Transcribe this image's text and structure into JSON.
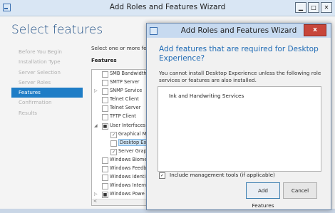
{
  "main": {
    "title": "Add Roles and Features Wizard",
    "heading": "Select features",
    "nav": [
      {
        "label": "Before You Begin",
        "active": false
      },
      {
        "label": "Installation Type",
        "active": false
      },
      {
        "label": "Server Selection",
        "active": false
      },
      {
        "label": "Server Roles",
        "active": false
      },
      {
        "label": "Features",
        "active": true
      },
      {
        "label": "Confirmation",
        "active": false
      },
      {
        "label": "Results",
        "active": false
      }
    ],
    "instruction": "Select one or more featu",
    "features_header": "Features",
    "features": [
      {
        "label": "SMB Bandwidth",
        "level": 0,
        "check": "",
        "exp": ""
      },
      {
        "label": "SMTP Server",
        "level": 0,
        "check": "",
        "exp": ""
      },
      {
        "label": "SNMP Service",
        "level": 0,
        "check": "",
        "exp": "▷"
      },
      {
        "label": "Telnet Client",
        "level": 0,
        "check": "",
        "exp": ""
      },
      {
        "label": "Telnet Server",
        "level": 0,
        "check": "",
        "exp": ""
      },
      {
        "label": "TFTP Client",
        "level": 0,
        "check": "",
        "exp": ""
      },
      {
        "label": "User Interfaces a",
        "level": 0,
        "check": "■",
        "exp": "◢"
      },
      {
        "label": "Graphical Mi",
        "level": 1,
        "check": "✓",
        "exp": ""
      },
      {
        "label": "Desktop Exp",
        "level": 1,
        "check": "",
        "exp": "",
        "selected": true
      },
      {
        "label": "Server Graph",
        "level": 1,
        "check": "✓",
        "exp": ""
      },
      {
        "label": "Windows Biome",
        "level": 0,
        "check": "",
        "exp": ""
      },
      {
        "label": "Windows Feedb",
        "level": 0,
        "check": "",
        "exp": ""
      },
      {
        "label": "Windows Identi",
        "level": 0,
        "check": "",
        "exp": ""
      },
      {
        "label": "Windows Intern",
        "level": 0,
        "check": "",
        "exp": ""
      },
      {
        "label": "Windows Powe",
        "level": 0,
        "check": "■",
        "exp": "▷"
      }
    ]
  },
  "dialog": {
    "title": "Add Roles and Features Wizard",
    "heading": "Add features that are required for Desktop Experience?",
    "message": "You cannot install Desktop Experience unless the following role services or features are also installed.",
    "required_item": "Ink and Handwriting Services",
    "include_tools": "Include management tools (if applicable)",
    "add_button": "Add Features",
    "cancel_button": "Cancel",
    "close_glyph": "x"
  }
}
